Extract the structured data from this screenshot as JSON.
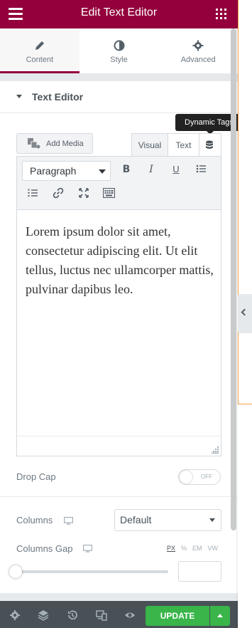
{
  "header": {
    "title": "Edit Text Editor"
  },
  "tabs": [
    {
      "label": "Content",
      "icon": "pencil-icon",
      "active": true
    },
    {
      "label": "Style",
      "icon": "contrast-icon",
      "active": false
    },
    {
      "label": "Advanced",
      "icon": "gear-icon",
      "active": false
    }
  ],
  "section": {
    "title": "Text Editor"
  },
  "tooltip": {
    "text": "Dynamic Tags"
  },
  "editor": {
    "add_media_label": "Add Media",
    "visual_tab": "Visual",
    "text_tab": "Text",
    "format_value": "Paragraph",
    "content": "Lorem ipsum dolor sit amet, consectetur adipiscing elit. Ut elit tellus, luctus nec ullamcorper mattis, pulvinar dapibus leo."
  },
  "controls": {
    "drop_cap_label": "Drop Cap",
    "drop_cap_state": "OFF",
    "columns_label": "Columns",
    "columns_value": "Default",
    "columns_gap_label": "Columns Gap",
    "units": [
      "PX",
      "%",
      "EM",
      "VW"
    ],
    "active_unit": "PX",
    "columns_gap_value": ""
  },
  "footer": {
    "update_label": "UPDATE"
  },
  "colors": {
    "brand": "#93003c",
    "update": "#39b54a",
    "footer": "#495157"
  }
}
